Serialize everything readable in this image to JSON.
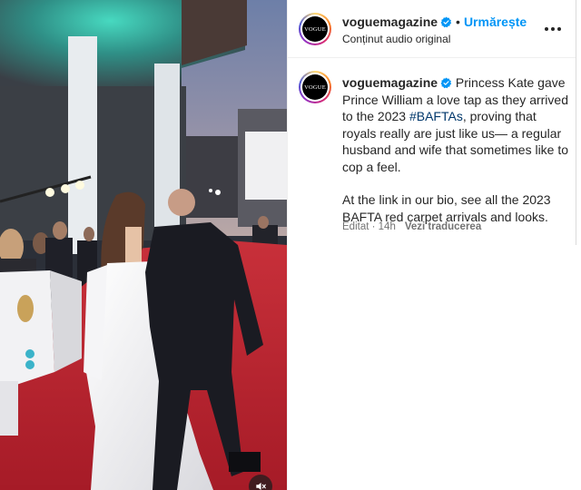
{
  "post": {
    "username": "voguemagazine",
    "avatar_text": "VOGUE",
    "follow_label": "Urmărește",
    "separator": "•",
    "audio_label": "Conținut audio original",
    "caption_part1": "Princess Kate gave Prince William a love tap as they arrived to the 2023 ",
    "hashtag": "#BAFTAs",
    "caption_part2": ", proving that royals really are just like us— a regular husband and wife that sometimes like to cop a feel.",
    "caption_para2": "At the link in our bio, see all the 2023 BAFTA red carpet arrivals and looks.",
    "edited_label": "Editat",
    "time": "14h",
    "translate_label": "Vezi traducerea"
  },
  "icons": {
    "verified": "verified-badge-icon",
    "more": "more-options-icon",
    "mute": "muted-speaker-icon"
  },
  "colors": {
    "follow_blue": "#0095f6",
    "hashtag_blue": "#00376b",
    "verified_blue": "#0095f6",
    "red_carpet": "#b01e2a"
  }
}
